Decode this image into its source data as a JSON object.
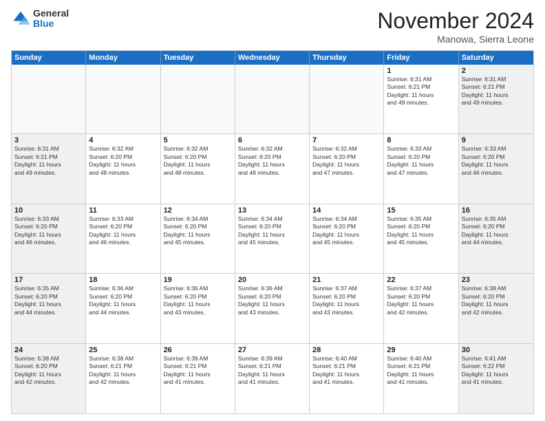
{
  "logo": {
    "general": "General",
    "blue": "Blue"
  },
  "title": "November 2024",
  "location": "Manowa, Sierra Leone",
  "days_header": [
    "Sunday",
    "Monday",
    "Tuesday",
    "Wednesday",
    "Thursday",
    "Friday",
    "Saturday"
  ],
  "weeks": [
    [
      {
        "day": "",
        "info": ""
      },
      {
        "day": "",
        "info": ""
      },
      {
        "day": "",
        "info": ""
      },
      {
        "day": "",
        "info": ""
      },
      {
        "day": "",
        "info": ""
      },
      {
        "day": "1",
        "info": "Sunrise: 6:31 AM\nSunset: 6:21 PM\nDaylight: 11 hours\nand 49 minutes."
      },
      {
        "day": "2",
        "info": "Sunrise: 6:31 AM\nSunset: 6:21 PM\nDaylight: 11 hours\nand 49 minutes."
      }
    ],
    [
      {
        "day": "3",
        "info": "Sunrise: 6:31 AM\nSunset: 6:21 PM\nDaylight: 11 hours\nand 49 minutes."
      },
      {
        "day": "4",
        "info": "Sunrise: 6:32 AM\nSunset: 6:20 PM\nDaylight: 11 hours\nand 48 minutes."
      },
      {
        "day": "5",
        "info": "Sunrise: 6:32 AM\nSunset: 6:20 PM\nDaylight: 11 hours\nand 48 minutes."
      },
      {
        "day": "6",
        "info": "Sunrise: 6:32 AM\nSunset: 6:20 PM\nDaylight: 11 hours\nand 48 minutes."
      },
      {
        "day": "7",
        "info": "Sunrise: 6:32 AM\nSunset: 6:20 PM\nDaylight: 11 hours\nand 47 minutes."
      },
      {
        "day": "8",
        "info": "Sunrise: 6:33 AM\nSunset: 6:20 PM\nDaylight: 11 hours\nand 47 minutes."
      },
      {
        "day": "9",
        "info": "Sunrise: 6:33 AM\nSunset: 6:20 PM\nDaylight: 11 hours\nand 46 minutes."
      }
    ],
    [
      {
        "day": "10",
        "info": "Sunrise: 6:33 AM\nSunset: 6:20 PM\nDaylight: 11 hours\nand 46 minutes."
      },
      {
        "day": "11",
        "info": "Sunrise: 6:33 AM\nSunset: 6:20 PM\nDaylight: 11 hours\nand 46 minutes."
      },
      {
        "day": "12",
        "info": "Sunrise: 6:34 AM\nSunset: 6:20 PM\nDaylight: 11 hours\nand 45 minutes."
      },
      {
        "day": "13",
        "info": "Sunrise: 6:34 AM\nSunset: 6:20 PM\nDaylight: 11 hours\nand 45 minutes."
      },
      {
        "day": "14",
        "info": "Sunrise: 6:34 AM\nSunset: 6:20 PM\nDaylight: 11 hours\nand 45 minutes."
      },
      {
        "day": "15",
        "info": "Sunrise: 6:35 AM\nSunset: 6:20 PM\nDaylight: 11 hours\nand 45 minutes."
      },
      {
        "day": "16",
        "info": "Sunrise: 6:35 AM\nSunset: 6:20 PM\nDaylight: 11 hours\nand 44 minutes."
      }
    ],
    [
      {
        "day": "17",
        "info": "Sunrise: 6:35 AM\nSunset: 6:20 PM\nDaylight: 11 hours\nand 44 minutes."
      },
      {
        "day": "18",
        "info": "Sunrise: 6:36 AM\nSunset: 6:20 PM\nDaylight: 11 hours\nand 44 minutes."
      },
      {
        "day": "19",
        "info": "Sunrise: 6:36 AM\nSunset: 6:20 PM\nDaylight: 11 hours\nand 43 minutes."
      },
      {
        "day": "20",
        "info": "Sunrise: 6:36 AM\nSunset: 6:20 PM\nDaylight: 11 hours\nand 43 minutes."
      },
      {
        "day": "21",
        "info": "Sunrise: 6:37 AM\nSunset: 6:20 PM\nDaylight: 11 hours\nand 43 minutes."
      },
      {
        "day": "22",
        "info": "Sunrise: 6:37 AM\nSunset: 6:20 PM\nDaylight: 11 hours\nand 42 minutes."
      },
      {
        "day": "23",
        "info": "Sunrise: 6:38 AM\nSunset: 6:20 PM\nDaylight: 11 hours\nand 42 minutes."
      }
    ],
    [
      {
        "day": "24",
        "info": "Sunrise: 6:38 AM\nSunset: 6:20 PM\nDaylight: 11 hours\nand 42 minutes."
      },
      {
        "day": "25",
        "info": "Sunrise: 6:38 AM\nSunset: 6:21 PM\nDaylight: 11 hours\nand 42 minutes."
      },
      {
        "day": "26",
        "info": "Sunrise: 6:39 AM\nSunset: 6:21 PM\nDaylight: 11 hours\nand 41 minutes."
      },
      {
        "day": "27",
        "info": "Sunrise: 6:39 AM\nSunset: 6:21 PM\nDaylight: 11 hours\nand 41 minutes."
      },
      {
        "day": "28",
        "info": "Sunrise: 6:40 AM\nSunset: 6:21 PM\nDaylight: 11 hours\nand 41 minutes."
      },
      {
        "day": "29",
        "info": "Sunrise: 6:40 AM\nSunset: 6:21 PM\nDaylight: 11 hours\nand 41 minutes."
      },
      {
        "day": "30",
        "info": "Sunrise: 6:41 AM\nSunset: 6:22 PM\nDaylight: 11 hours\nand 41 minutes."
      }
    ]
  ]
}
